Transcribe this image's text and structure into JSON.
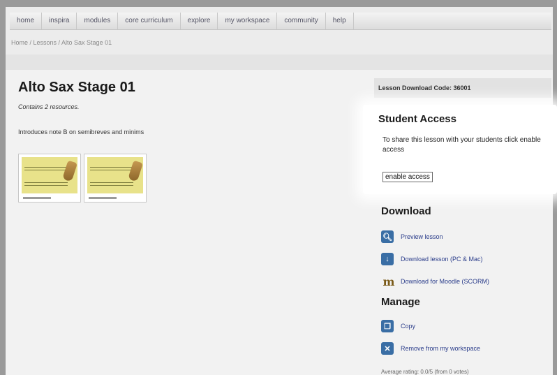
{
  "nav": {
    "items": [
      "home",
      "inspira",
      "modules",
      "core curriculum",
      "explore",
      "my workspace",
      "community",
      "help"
    ]
  },
  "breadcrumb": "Home / Lessons / Alto Sax Stage 01",
  "lesson": {
    "title": "Alto Sax Stage 01",
    "resources": "Contains 2 resources.",
    "description": "Introduces note B on semibreves and minims"
  },
  "sidebar": {
    "download_code": "Lesson Download Code: 36001",
    "student_access": {
      "title": "Student Access",
      "text": "To share this lesson with your students click enable access",
      "button": "enable access"
    },
    "download": {
      "title": "Download",
      "links": [
        {
          "label": "Preview lesson",
          "icon": "magnifier-icon"
        },
        {
          "label": "Download lesson (PC & Mac)",
          "icon": "download-arrow-icon"
        },
        {
          "label": "Download for Moodle (SCORM)",
          "icon": "moodle-icon"
        }
      ]
    },
    "manage": {
      "title": "Manage",
      "links": [
        {
          "label": "Copy",
          "icon": "copy-icon"
        },
        {
          "label": "Remove from my workspace",
          "icon": "remove-icon"
        }
      ]
    },
    "footer": "Average rating: 0.0/5 (from 0 votes)"
  }
}
